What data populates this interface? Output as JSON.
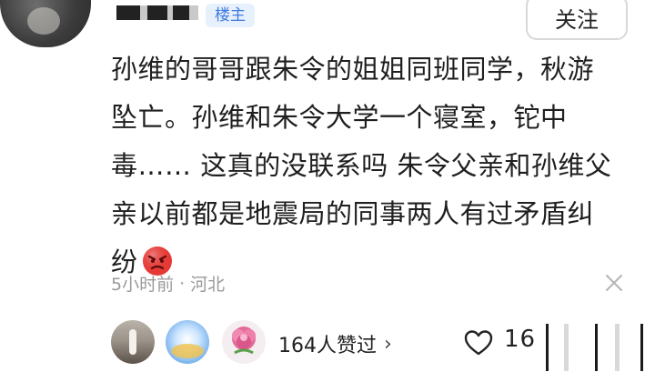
{
  "header": {
    "owner_badge": "楼主",
    "follow_label": "关注"
  },
  "post": {
    "text": "孙维的哥哥跟朱令的姐姐同班同学，秋游坠亡。孙维和朱令大学一个寝室，铊中毒…… 这真的没联系吗 朱令父亲和孙维父亲以前都是地震局的同事两人有过矛盾纠纷",
    "emoji": "angry-face-emoji"
  },
  "meta": {
    "time": "5小时前",
    "separator": "·",
    "location": "河北",
    "dismiss_icon": "close-icon"
  },
  "likes": {
    "summary": "164人赞过",
    "chevron": "›",
    "count_partial": "16",
    "like_icon": "heart-outline-icon",
    "avatars": [
      "liker-avatar-1",
      "liker-avatar-2",
      "liker-avatar-3"
    ]
  },
  "colors": {
    "badge_bg": "#e7f0fd",
    "badge_text": "#3f7ae0",
    "meta_text": "#9a9a9a",
    "emoji_red": "#e53935"
  }
}
